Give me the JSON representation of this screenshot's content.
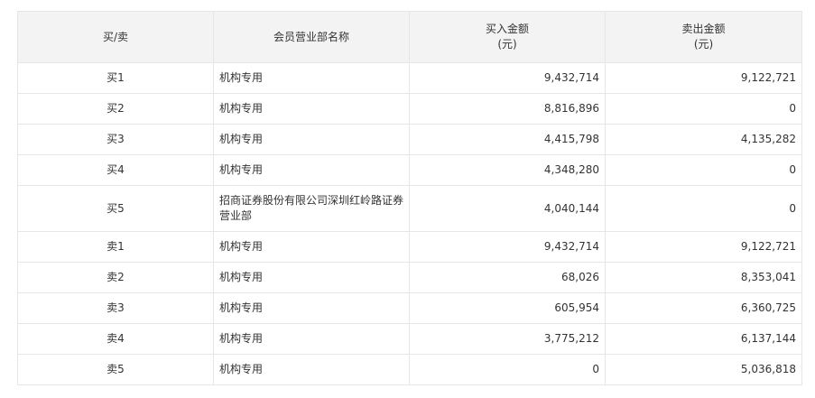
{
  "table": {
    "headers": {
      "side": "买/卖",
      "name": "会员营业部名称",
      "buy_line1": "买入金额",
      "buy_line2": "(元)",
      "sell_line1": "卖出金额",
      "sell_line2": "(元)"
    },
    "rows": [
      {
        "side": "买1",
        "name": "机构专用",
        "buy": "9,432,714",
        "sell": "9,122,721"
      },
      {
        "side": "买2",
        "name": "机构专用",
        "buy": "8,816,896",
        "sell": "0"
      },
      {
        "side": "买3",
        "name": "机构专用",
        "buy": "4,415,798",
        "sell": "4,135,282"
      },
      {
        "side": "买4",
        "name": "机构专用",
        "buy": "4,348,280",
        "sell": "0"
      },
      {
        "side": "买5",
        "name": "招商证券股份有限公司深圳红岭路证券营业部",
        "buy": "4,040,144",
        "sell": "0"
      },
      {
        "side": "卖1",
        "name": "机构专用",
        "buy": "9,432,714",
        "sell": "9,122,721"
      },
      {
        "side": "卖2",
        "name": "机构专用",
        "buy": "68,026",
        "sell": "8,353,041"
      },
      {
        "side": "卖3",
        "name": "机构专用",
        "buy": "605,954",
        "sell": "6,360,725"
      },
      {
        "side": "卖4",
        "name": "机构专用",
        "buy": "3,775,212",
        "sell": "6,137,144"
      },
      {
        "side": "卖5",
        "name": "机构专用",
        "buy": "0",
        "sell": "5,036,818"
      }
    ]
  }
}
